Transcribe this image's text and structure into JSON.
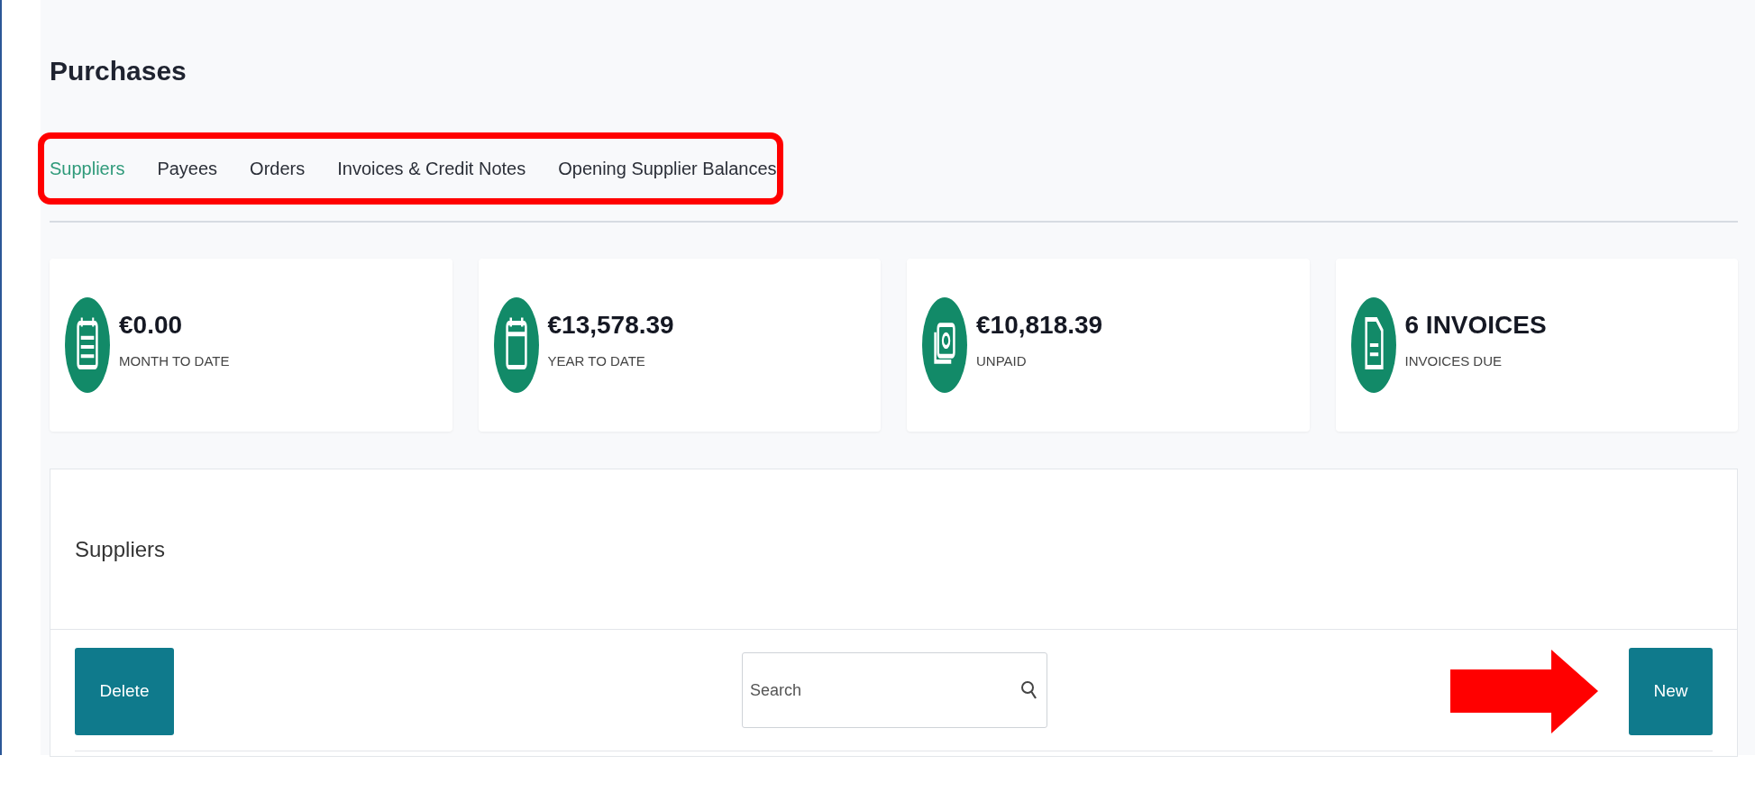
{
  "page": {
    "title": "Purchases"
  },
  "tabs": [
    {
      "label": "Suppliers",
      "selected": true
    },
    {
      "label": "Payees",
      "selected": false
    },
    {
      "label": "Orders",
      "selected": false
    },
    {
      "label": "Invoices & Credit Notes",
      "selected": false
    },
    {
      "label": "Opening Supplier Balances",
      "selected": false
    }
  ],
  "summary_cards": [
    {
      "kind": "month",
      "value": "€0.00",
      "label": "MONTH TO DATE"
    },
    {
      "kind": "year",
      "value": "€13,578.39",
      "label": "YEAR TO DATE"
    },
    {
      "kind": "unpaid",
      "value": "€10,818.39",
      "label": "UNPAID"
    },
    {
      "kind": "invoices",
      "value": "6 INVOICES",
      "label": "INVOICES DUE"
    }
  ],
  "panel": {
    "title": "Suppliers",
    "delete_button": "Delete",
    "search": {
      "placeholder": "Search"
    },
    "new_button": "New"
  }
}
